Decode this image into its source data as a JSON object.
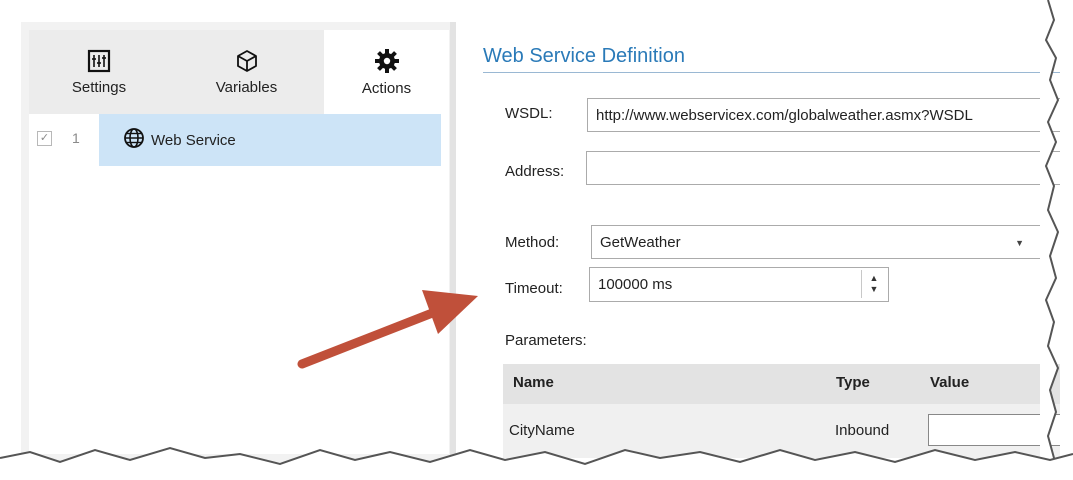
{
  "left_pane": {
    "tabs": [
      {
        "label": "Settings",
        "icon": "sliders-icon"
      },
      {
        "label": "Variables",
        "icon": "cube-icon"
      },
      {
        "label": "Actions",
        "icon": "gear-icon",
        "selected": true
      }
    ],
    "actions": [
      {
        "index": "1",
        "label": "Web Service",
        "checked": true,
        "icon": "globe-icon"
      }
    ]
  },
  "right_pane": {
    "title": "Web Service Definition",
    "wsdl": {
      "label": "WSDL:",
      "value": "http://www.webservicex.com/globalweather.asmx?WSDL"
    },
    "address": {
      "label": "Address:",
      "value": ""
    },
    "method": {
      "label": "Method:",
      "value": "GetWeather"
    },
    "timeout": {
      "label": "Timeout:",
      "value": "100000 ms"
    },
    "parameters": {
      "label": "Parameters:",
      "columns": [
        "Name",
        "Type",
        "Value"
      ],
      "rows": [
        {
          "name": "CityName",
          "type": "Inbound",
          "value": ""
        }
      ]
    }
  },
  "colors": {
    "accent": "#2a7ab8",
    "selection": "#cde4f7",
    "arrow": "#c0503a"
  }
}
